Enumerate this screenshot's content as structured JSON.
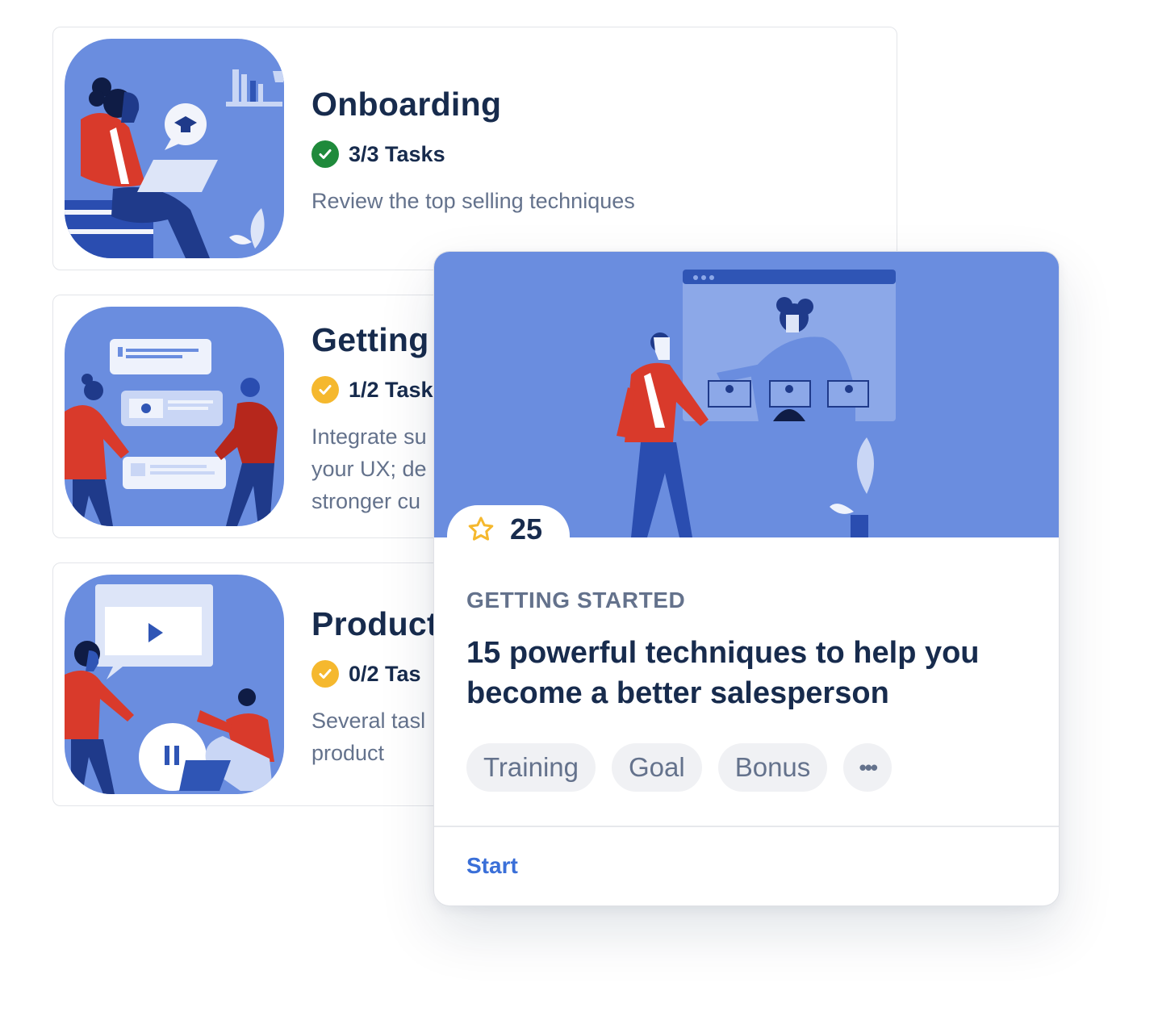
{
  "courses": [
    {
      "title": "Onboarding",
      "tasks": "3/3 Tasks",
      "status": "complete",
      "status_color": "#1f8a3b",
      "description": "Review the top selling techniques"
    },
    {
      "title": "Getting",
      "tasks": "1/2 Task",
      "status": "in-progress",
      "status_color": "#f5b82e",
      "description": "Integrate su your UX; de stronger cu"
    },
    {
      "title": "Product",
      "tasks": "0/2 Tas",
      "status": "in-progress",
      "status_color": "#f5b82e",
      "description": "Several tasl product"
    }
  ],
  "detail": {
    "points": "25",
    "category": "GETTING STARTED",
    "title": "15 powerful techniques to help you become a better salesperson",
    "tags": [
      "Training",
      "Goal",
      "Bonus"
    ],
    "more_label": "•••",
    "cta": "Start"
  },
  "colors": {
    "illustration_bg": "#6a8ddf",
    "accent": "#3a6fd8",
    "text": "#172b4d",
    "muted": "#64728c",
    "tag_bg": "#f0f1f4",
    "star": "#f5b82e"
  }
}
